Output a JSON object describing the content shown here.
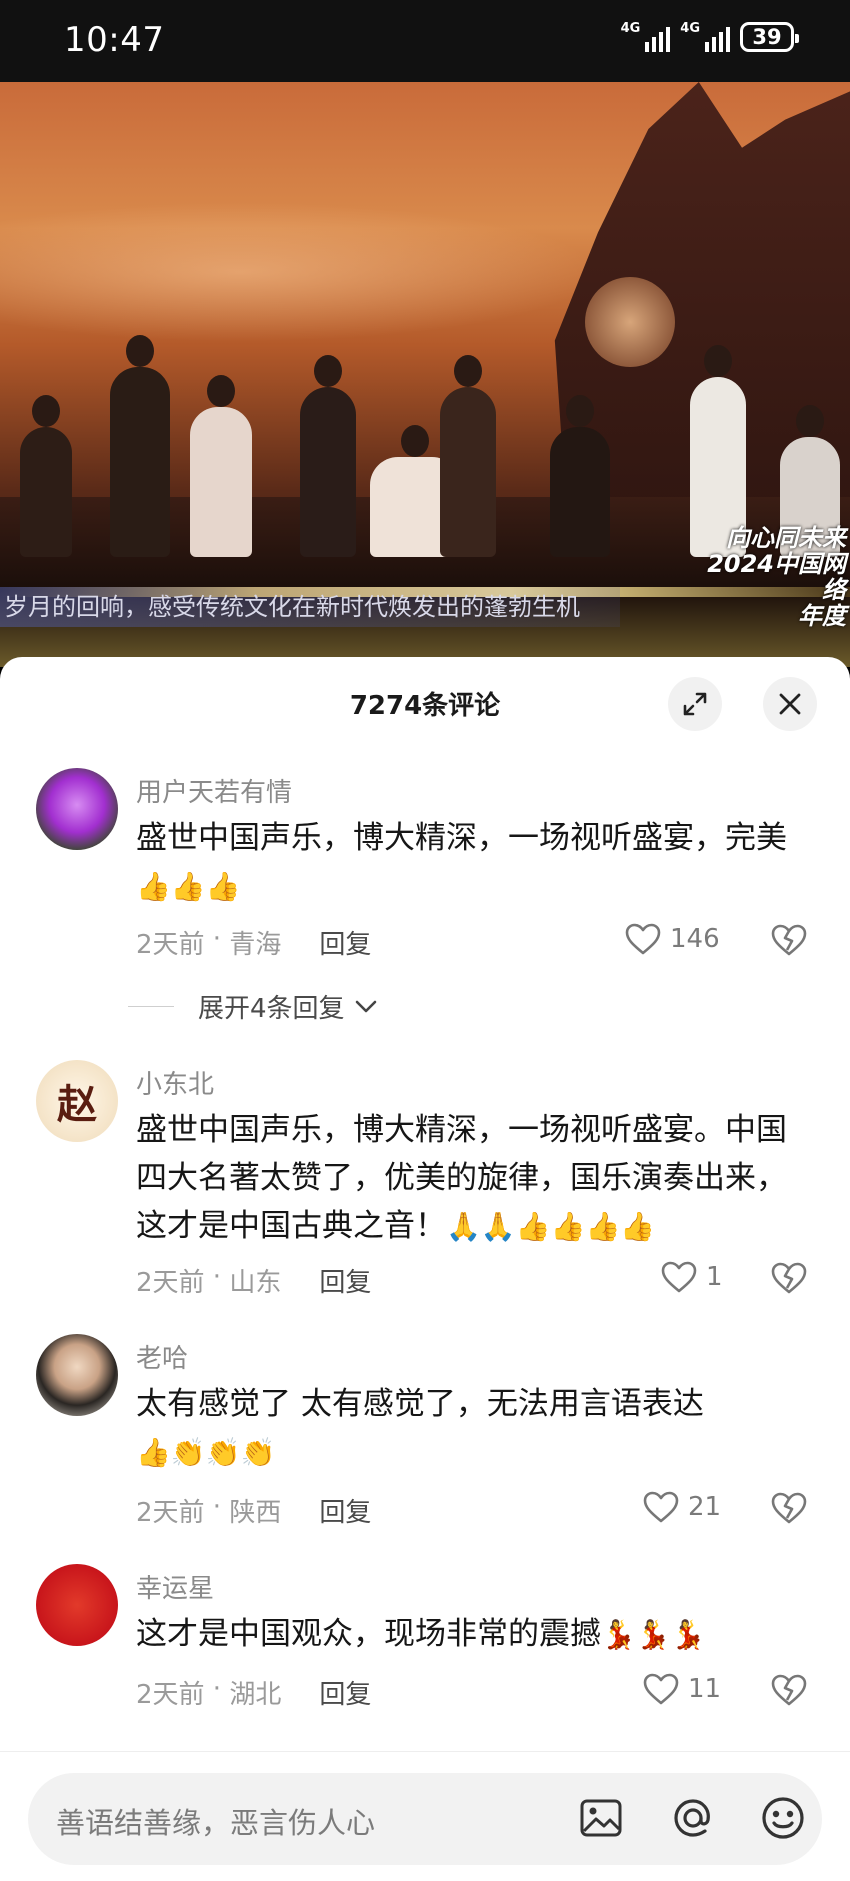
{
  "status_bar": {
    "time": "10:47",
    "network1": "4G",
    "network2": "4G",
    "battery": "39"
  },
  "video": {
    "subtitle": "岁月的回响，感受传统文化在新时代焕发出的蓬勃生机",
    "logo_line1": "向心同未来",
    "logo_line2": "2024中国网络",
    "logo_line3": "年度"
  },
  "panel": {
    "title": "7274条评论"
  },
  "comments": [
    {
      "user": "用户天若有情",
      "text": "盛世中国声乐，博大精深，一场视听盛宴，完美",
      "emoji": "👍👍👍",
      "time": "2天前",
      "region": "青海",
      "reply": "回复",
      "likes": "146"
    },
    {
      "user": "小东北",
      "text": "盛世中国声乐，博大精深，一场视听盛宴。中国四大名著太赞了，优美的旋律，国乐演奏出来，这才是中国古典之音！",
      "emoji": "🙏🙏👍👍👍👍",
      "time": "2天前",
      "region": "山东",
      "reply": "回复",
      "likes": "1"
    },
    {
      "user": "老哈",
      "text": "太有感觉了 太有感觉了，无法用言语表达",
      "emoji": "👍👏👏👏",
      "time": "2天前",
      "region": "陕西",
      "reply": "回复",
      "likes": "21"
    },
    {
      "user": "幸运星",
      "text": "这才是中国观众，现场非常的震撼",
      "emoji": "💃💃💃",
      "time": "2天前",
      "region": "湖北",
      "reply": "回复",
      "likes": "11"
    }
  ],
  "expand_replies": "展开4条回复",
  "avatar2_char": "赵",
  "bottom_bar": {
    "placeholder": "善语结善缘，恶言伤人心"
  },
  "colors": {
    "panel_bg": "#ffffff",
    "muted_text": "#8a8a8a",
    "avatar1": "#a22fd0",
    "avatar4": "#c8151b"
  }
}
